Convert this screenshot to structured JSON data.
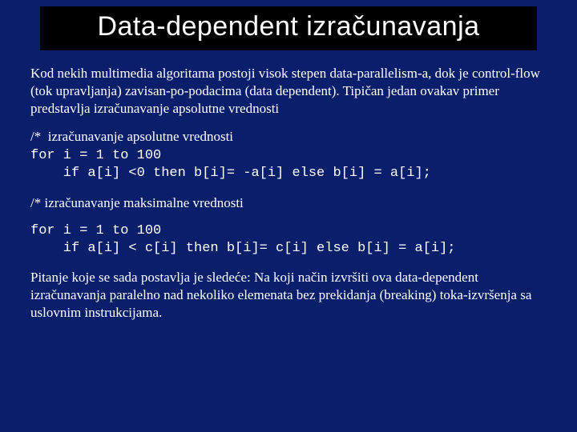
{
  "title": "Data-dependent izračunavanja",
  "para1": "Kod nekih multimedia algoritama postoji visok stepen data-parallelism-a, dok je control-flow (tok upravljanja) zavisan-po-podacima (data dependent). Tipičan jedan ovakav primer predstavlja izračunavanje apsolutne vrednosti",
  "code1_comment": "/*  izračunavanje apsolutne vrednosti",
  "code1": "for i = 1 to 100\n    if a[i] <0 then b[i]= -a[i] else b[i] = a[i];",
  "code2_comment": "/* izračunavanje maksimalne vrednosti",
  "code2": "for i = 1 to 100\n    if a[i] < c[i] then b[i]= c[i] else b[i] = a[i];",
  "para2": "Pitanje koje se sada postavlja je sledeće: Na koji način izvršiti ova data-dependent izračunavanja paralelno nad nekoliko elemenata bez prekidanja (breaking) toka-izvršenja sa uslovnim instrukcijama."
}
